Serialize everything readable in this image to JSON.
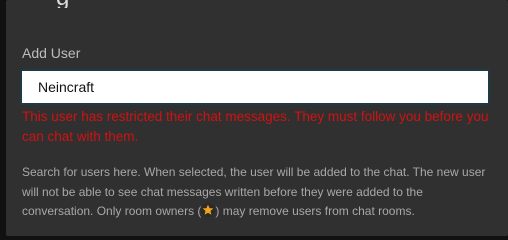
{
  "dialog": {
    "title_fragment": "g"
  },
  "add_user": {
    "label": "Add User",
    "value": "Neincraft",
    "error": "This user has restricted their chat messages. They must follow you before you can chat with them."
  },
  "help": {
    "part1": "Search for users here. When selected, the user will be added to the chat. The new user will not be able to see chat messages written before they were added to the conversation. Only room owners (",
    "part2": ") may remove users from chat rooms."
  },
  "icons": {
    "owner": "star-icon"
  },
  "colors": {
    "error": "#d11212",
    "dialog_bg": "#303030",
    "input_border": "#1e3a47",
    "star": "#f2a51a"
  }
}
